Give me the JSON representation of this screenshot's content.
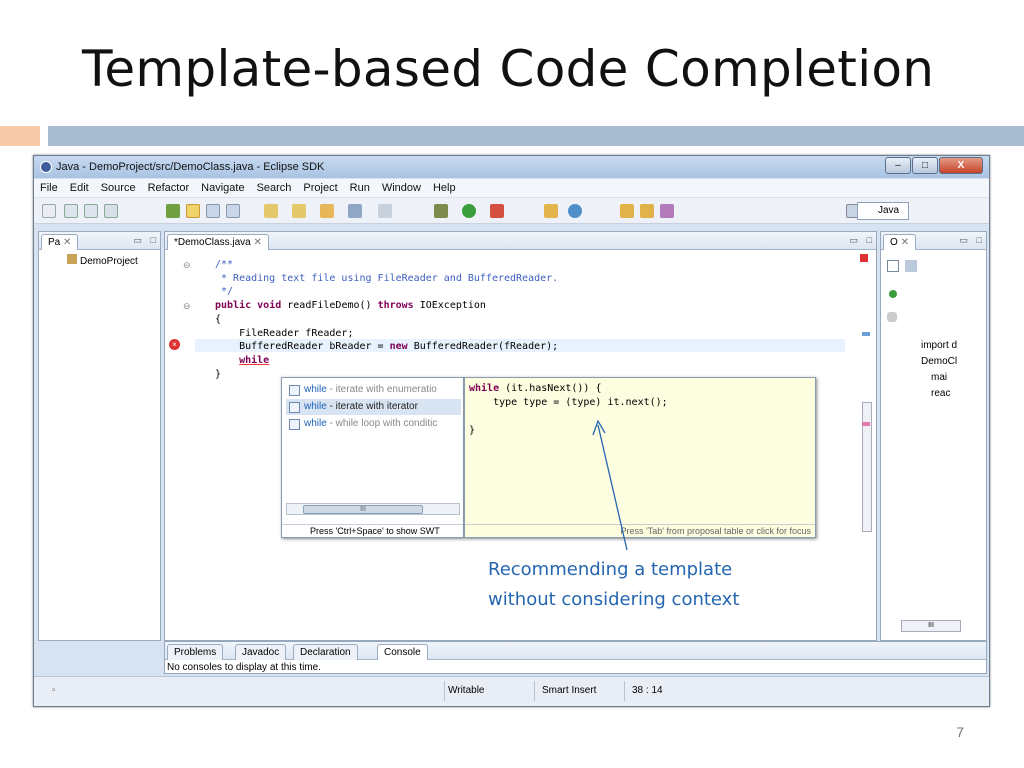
{
  "slide": {
    "title": "Template-based Code Completion",
    "page_number": "7",
    "annotation_line1": "Recommending a template",
    "annotation_line2": "without considering context"
  },
  "window": {
    "title": "Java - DemoProject/src/DemoClass.java - Eclipse SDK",
    "min_label": "–",
    "max_label": "□",
    "close_label": "X"
  },
  "menu": [
    "File",
    "Edit",
    "Source",
    "Refactor",
    "Navigate",
    "Search",
    "Project",
    "Run",
    "Window",
    "Help"
  ],
  "toolbar": {
    "perspective_label": "Java"
  },
  "package_explorer": {
    "tab_label": "Pa",
    "project": "DemoProject"
  },
  "editor": {
    "tab_label": "*DemoClass.java",
    "code_lines": [
      "/**",
      " * Reading text file using FileReader and BufferedReader.",
      " */",
      "public void readFileDemo() throws IOException",
      "{",
      "    FileReader fReader;",
      "    BufferedReader bReader = new BufferedReader(fReader);",
      "    while",
      "}"
    ]
  },
  "completion": {
    "proposals": [
      {
        "keyword": "while",
        "desc": " - iterate with enumeratio"
      },
      {
        "keyword": "while",
        "desc": " - iterate with iterator"
      },
      {
        "keyword": "while",
        "desc": " - while loop with conditic"
      }
    ],
    "selected_index": 1,
    "scroll_thumb_label": "III",
    "hint": "Press 'Ctrl+Space' to show SWT",
    "preview_lines": [
      "while (it.hasNext()) {",
      "    type type = (type) it.next();",
      "",
      "}"
    ],
    "preview_footer": "Press 'Tab' from proposal table or click for focus"
  },
  "outline": {
    "tab_label": "O",
    "items": [
      "import d",
      "DemoCl",
      "mai",
      "reac"
    ],
    "scroll_label": "III"
  },
  "bottom_tabs": {
    "tabs": [
      "Problems",
      "Javadoc",
      "Declaration",
      "Console"
    ],
    "console_message": "No consoles to display at this time."
  },
  "status": {
    "writable": "Writable",
    "insert_mode": "Smart Insert",
    "position": "38 : 14"
  }
}
